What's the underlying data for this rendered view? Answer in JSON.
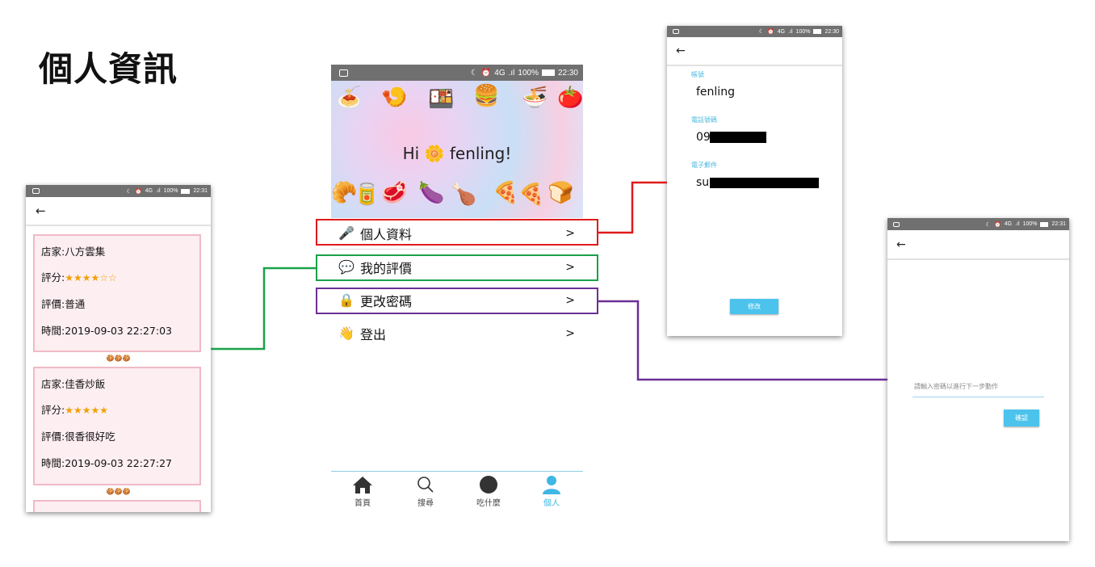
{
  "slide": {
    "title": "個人資訊"
  },
  "colors": {
    "red": "#e01a1a",
    "green": "#1aa14a",
    "purple": "#6b2f95",
    "accent": "#3fb6e6",
    "card_bg": "#fdeef2",
    "card_border": "#efbac6"
  },
  "status_bar_main": {
    "signal": "4G",
    "battery": "100%",
    "time": "22:30"
  },
  "status_bar_ratings": {
    "signal": "4G",
    "battery": "100%",
    "time": "22:31"
  },
  "status_bar_profile": {
    "signal": "4G",
    "battery": "100%",
    "time": "22:30"
  },
  "status_bar_password": {
    "signal": "4G",
    "battery": "100%",
    "time": "22:31"
  },
  "main": {
    "greeting_hi": "Hi",
    "greeting_name": "fenling!",
    "menu": [
      {
        "icon": "microphone-icon",
        "label": "個人資料",
        "chevron": ">"
      },
      {
        "icon": "speech-bubble-icon",
        "label": "我的評價",
        "chevron": ">"
      },
      {
        "icon": "lock-icon",
        "label": "更改密碼",
        "chevron": ">"
      },
      {
        "icon": "waving-hand-icon",
        "label": "登出",
        "chevron": ">"
      }
    ],
    "tabs": [
      {
        "icon": "home-icon",
        "label": "首頁"
      },
      {
        "icon": "search-icon",
        "label": "搜尋"
      },
      {
        "icon": "dot-icon",
        "label": "吃什麼"
      },
      {
        "icon": "person-icon",
        "label": "個人"
      }
    ]
  },
  "ratings": {
    "reviews": [
      {
        "store_label": "店家:",
        "store": "八方雲集",
        "score_label": "評分:",
        "stars": "★★★★☆☆",
        "comment_label": "評價:",
        "comment": "普通",
        "time_label": "時間:",
        "time": "2019-09-03 22:27:03"
      },
      {
        "store_label": "店家:",
        "store": "佳香炒飯",
        "score_label": "評分:",
        "stars": "★★★★★",
        "comment_label": "評價:",
        "comment": "很香很好吃",
        "time_label": "時間:",
        "time": "2019-09-03 22:27:27"
      }
    ]
  },
  "profile": {
    "account_label": "帳號",
    "account_value": "fenling",
    "phone_label": "電話號碼",
    "phone_value": "09",
    "email_label": "電子郵件",
    "email_value": "su",
    "edit_button": "修改"
  },
  "password": {
    "placeholder": "請輸入密碼以進行下一步動作",
    "confirm_button": "確認"
  }
}
